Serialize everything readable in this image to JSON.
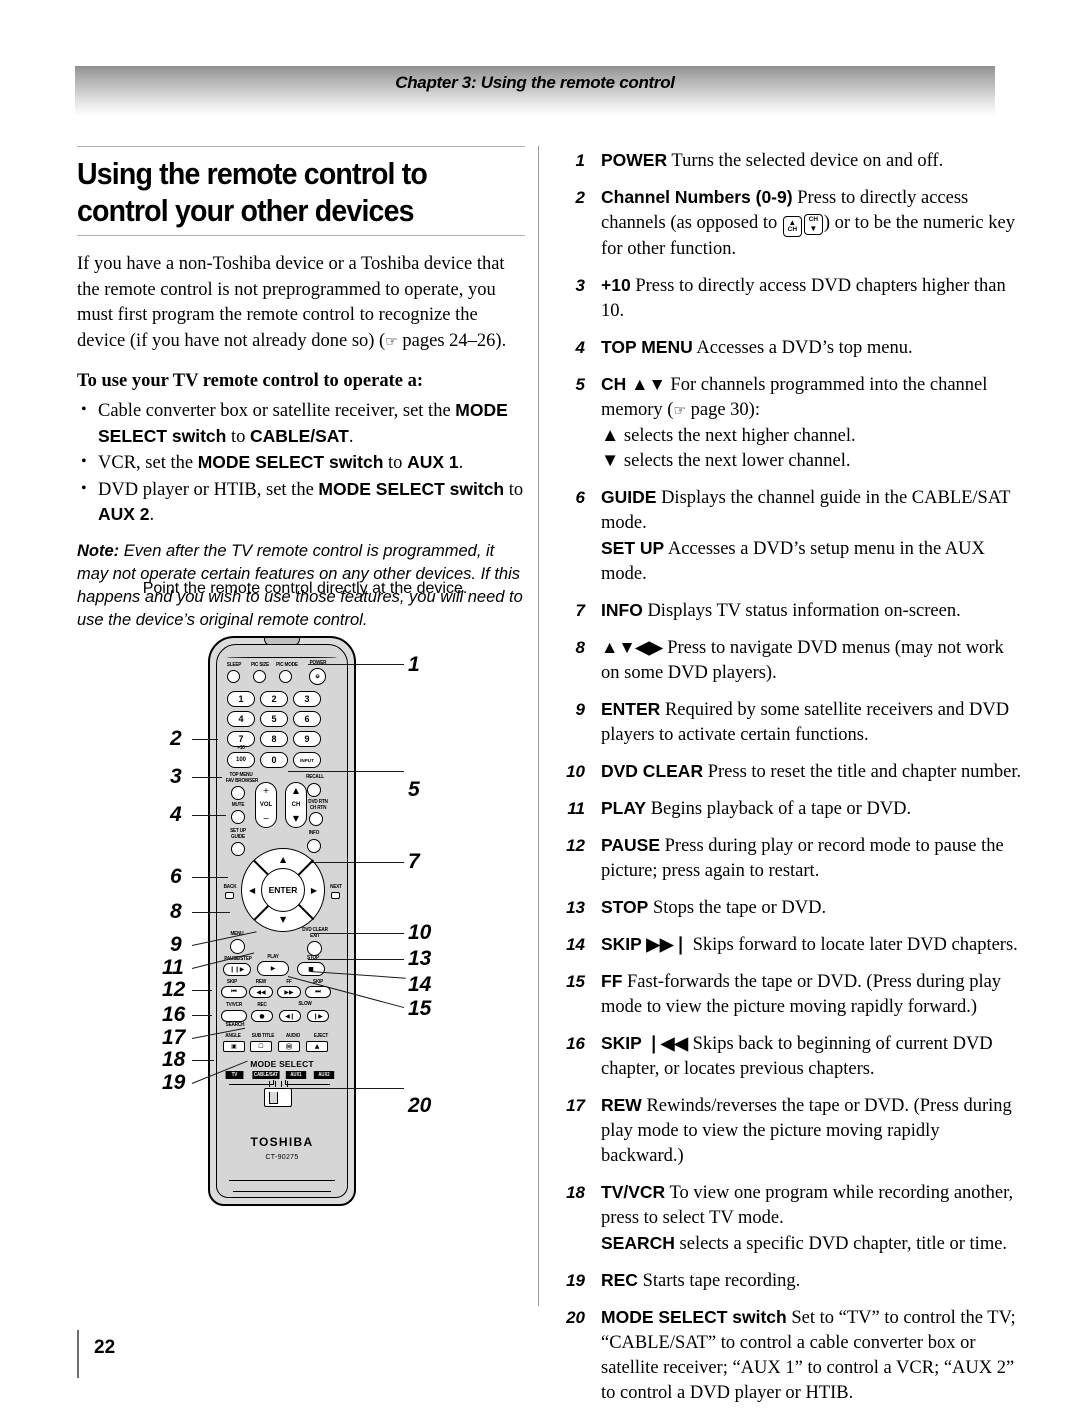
{
  "header": {
    "chapter_title": "Chapter 3: Using the remote control"
  },
  "page": {
    "number": "22"
  },
  "left": {
    "title": "Using the remote control to control your other devices",
    "intro": "If you have a non-Toshiba device or a Toshiba device that the remote control is not preprogrammed to operate, you must first program the remote control to recognize the device (if you have not already done so) (☞ pages 24–26).",
    "subhead": "To use your TV remote control to operate a:",
    "bullets": [
      "Cable converter box or satellite receiver, set the MODE SELECT switch to CABLE/SAT.",
      "VCR, set the MODE SELECT switch to AUX 1.",
      "DVD player or HTIB, set the MODE SELECT switch to AUX 2."
    ],
    "note_label": "Note:",
    "note_text": "Even after the TV remote control is programmed, it may not operate certain features on any other devices. If this happens and you wish to use those features, you will need to use the device’s original remote control.",
    "figure_caption": "Point the remote control directly at the device."
  },
  "items": [
    {
      "num": "1",
      "term": "POWER",
      "desc": "Turns the selected device on and off."
    },
    {
      "num": "2",
      "term": "Channel Numbers (0-9)",
      "desc": "Press to directly access channels (as opposed to ⒸⒸ) or to be the numeric key for other function."
    },
    {
      "num": "3",
      "term": "+10",
      "desc": "Press to directly access DVD chapters higher than 10."
    },
    {
      "num": "4",
      "term": "TOP MENU",
      "desc": "Accesses a DVD’s top menu."
    },
    {
      "num": "5",
      "term": "CH ▲▼",
      "desc": "For channels programmed into the channel memory (☞ page 30):"
    },
    {
      "num": "6",
      "term": "GUIDE",
      "desc": "Displays the channel guide in the CABLE/SAT mode."
    },
    {
      "num": "7",
      "term": "INFO",
      "desc": "Displays TV status information on-screen."
    },
    {
      "num": "8",
      "term": "▲▼◀▶",
      "desc": "Press to navigate DVD menus (may not work on some DVD players)."
    },
    {
      "num": "9",
      "term": "ENTER",
      "desc": "Required by some satellite receivers and DVD players to activate certain functions."
    },
    {
      "num": "10",
      "term": "DVD CLEAR",
      "desc": "Press to reset the title and chapter number."
    },
    {
      "num": "11",
      "term": "PLAY",
      "desc": "Begins playback of a tape or DVD."
    },
    {
      "num": "12",
      "term": "PAUSE",
      "desc": "Press during play or record mode to pause the picture; press again to restart."
    },
    {
      "num": "13",
      "term": "STOP",
      "desc": "Stops the tape or DVD."
    },
    {
      "num": "14",
      "term": "SKIP ▶▶❘",
      "desc": "Skips forward to locate later DVD chapters."
    },
    {
      "num": "15",
      "term": "FF",
      "desc": "Fast-forwards the tape or DVD. (Press during play mode to view the picture moving rapidly forward.)"
    },
    {
      "num": "16",
      "term": "SKIP ❘◀◀",
      "desc": "Skips back to beginning of current DVD chapter, or locates previous chapters."
    },
    {
      "num": "17",
      "term": "REW",
      "desc": "Rewinds/reverses the tape or DVD. (Press during play mode to view the picture moving rapidly backward.)"
    },
    {
      "num": "18",
      "term": "TV/VCR",
      "desc": "To view one program while recording another, press to select TV mode."
    },
    {
      "num": "19",
      "term": "REC",
      "desc": "Starts tape recording."
    },
    {
      "num": "20",
      "term": "MODE SELECT switch",
      "desc": "Set to “TV” to control the TV; “CABLE/SAT” to control a cable converter box or satellite receiver; “AUX 1” to control a VCR; “AUX 2” to control a DVD player or HTIB."
    }
  ],
  "item5_sub": [
    "▲ selects the next higher channel.",
    "▼ selects the next lower channel."
  ],
  "item6_sub": {
    "term": "SET UP",
    "desc": "Accesses a DVD’s setup menu in the AUX mode."
  },
  "item18_sub": {
    "term": "SEARCH",
    "desc": "selects a specific DVD chapter, title or time."
  },
  "remote": {
    "brand": "TOSHIBA",
    "model": "CT-90275",
    "mode_select_title": "MODE SELECT",
    "mode_tags": [
      "TV",
      "CABLE/SAT",
      "AUX1",
      "AUX2"
    ],
    "row_labels": {
      "sleep": "SLEEP",
      "pic_size": "PIC SIZE",
      "pic_mode": "PIC MODE",
      "power": "POWER",
      "top_menu": "TOP MENU",
      "fav_browser": "FAV BROWSER",
      "recall": "RECALL",
      "mute": "MUTE",
      "vol": "VOL",
      "ch": "CH",
      "dvd_rtn": "DVD RTN",
      "ch_rtn": "CH RTN",
      "set_up": "SET UP",
      "guide": "GUIDE",
      "info": "INFO",
      "back": "BACK",
      "next": "NEXT",
      "menu": "MENU",
      "dvd_clear": "DVD CLEAR",
      "exit": "EXIT",
      "pause_step": "PAUSE/STEP",
      "play": "PLAY",
      "stop": "STOP",
      "skip_back": "SKIP",
      "rew": "REW",
      "ff": "FF",
      "skip_fwd": "SKIP",
      "tv_vcr": "TV/VCR",
      "search": "SEARCH",
      "rec": "REC",
      "slow": "SLOW",
      "angle": "ANGLE",
      "sub_title": "SUB TITLE",
      "audio": "AUDIO",
      "eject": "EJECT",
      "plus_ten": "+10"
    },
    "keys": [
      "1",
      "2",
      "3",
      "4",
      "5",
      "6",
      "7",
      "8",
      "9",
      "100",
      "0",
      "INPUT"
    ],
    "enter": "ENTER"
  },
  "callouts_left": [
    "2",
    "3",
    "4",
    "6",
    "8",
    "9",
    "11",
    "12",
    "16",
    "17",
    "18",
    "19"
  ],
  "callouts_right": [
    "1",
    "5",
    "7",
    "10",
    "13",
    "14",
    "15",
    "20"
  ]
}
